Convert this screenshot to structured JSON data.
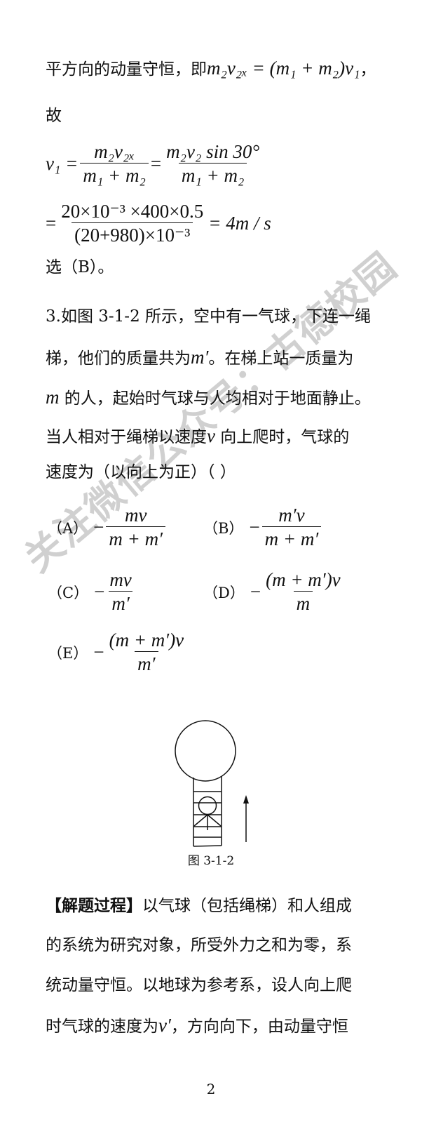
{
  "lines": {
    "l1_text": "平方向的动量守恒，即",
    "l1_eq": "m₂v₂ₓ = (m₁ + m₂)v₁",
    "l1_end": "，",
    "l2": "故",
    "l3_lhs": "v₁ =",
    "l3_f1_num": "m₂v₂ₓ",
    "l3_f1_den": "m₁ + m₂",
    "l3_f2_num": "m₂v₂ sin 30°",
    "l3_f2_den": "m₁ + m₂",
    "l4_num": "20×10⁻³ ×400×0.5",
    "l4_den": "(20+980)×10⁻³",
    "l4_result": "= 4m / s",
    "l5": "选（B）。",
    "q1": "3.如图 3-1-2 所示，空中有一气球，下连一绳",
    "q2a": "梯，他们的质量共为",
    "q2m": "m′",
    "q2b": "。在梯上站一质量为",
    "q3m": "m",
    "q3b": " 的人，起始时气球与人均相对于地面静止。",
    "q4a": "当人相对于绳梯以速度",
    "q4v": "v",
    "q4b": " 向上爬时，气球的",
    "q5": "速度为（以向上为正）（      ）"
  },
  "options": [
    {
      "label": "（A）",
      "sign": "−",
      "num": "mv",
      "den": "m + m′"
    },
    {
      "label": "（B）",
      "sign": "−",
      "num": "m′v",
      "den": "m + m′"
    },
    {
      "label": "（C）",
      "sign": "−",
      "num": "mv",
      "den": "m′"
    },
    {
      "label": "（D）",
      "sign": "−",
      "num": "(m + m′)v",
      "den": "m"
    },
    {
      "label": "（E）",
      "sign": "−",
      "num": "(m + m′)v",
      "den": "m′"
    }
  ],
  "figure": {
    "caption": "图 3-1-2"
  },
  "solution": {
    "s1_head": "【解题过程】",
    "s1": "以气球（包括绳梯）和人组成",
    "s2": "的系统为研究对象，所受外力之和为零，系",
    "s3": "统动量守恒。以地球为参考系，设人向上爬",
    "s4a": "时气球的速度为",
    "s4v": "v′",
    "s4b": "，方向向下，由动量守恒"
  },
  "watermark": "关注微信公众号：古德校园",
  "page_number": "2"
}
